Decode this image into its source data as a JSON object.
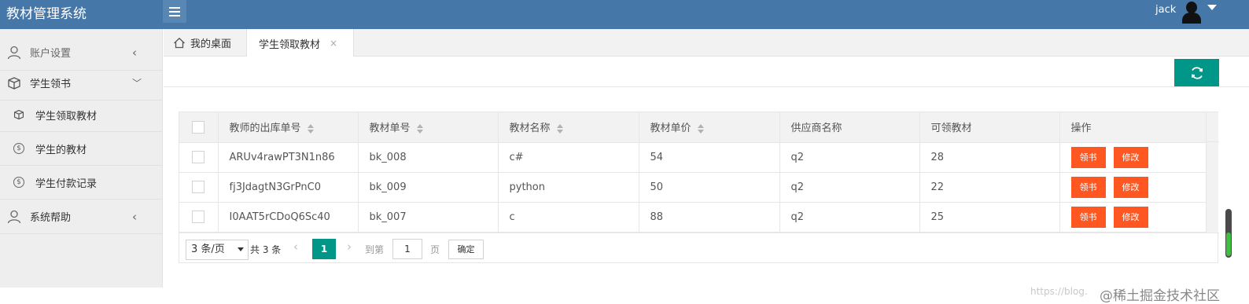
{
  "header": {
    "title": "教材管理系统",
    "user": "jack",
    "menu_icon": "hamburger-icon",
    "accent": "#4577a8"
  },
  "sidebar": {
    "items": [
      {
        "label": "账户设置",
        "icon": "user-icon",
        "arrow": "<"
      },
      {
        "label": "学生领书",
        "icon": "box-icon",
        "arrow": "v"
      },
      {
        "label": "学生领取教材",
        "icon": "box-icon"
      },
      {
        "label": "学生的教材",
        "icon": "dollar-circle-icon"
      },
      {
        "label": "学生付款记录",
        "icon": "dollar-circle-icon"
      },
      {
        "label": "系统帮助",
        "icon": "user-icon",
        "arrow": "<"
      }
    ]
  },
  "tabs": [
    {
      "label": "我的桌面",
      "icon": "home-icon"
    },
    {
      "label": "学生领取教材",
      "close": "×"
    }
  ],
  "table": {
    "columns": [
      "教师的出库单号",
      "教材单号",
      "教材名称",
      "教材单价",
      "供应商名称",
      "可领教材",
      "操作"
    ],
    "rows": [
      {
        "order": "ARUv4rawPT3N1n86",
        "book_id": "bk_008",
        "name": "c#",
        "price": "54",
        "supplier": "q2",
        "qty": "28"
      },
      {
        "order": "fj3JdagtN3GrPnC0",
        "book_id": "bk_009",
        "name": "python",
        "price": "50",
        "supplier": "q2",
        "qty": "22"
      },
      {
        "order": "I0AAT5rCDoQ6Sc40",
        "book_id": "bk_007",
        "name": "c",
        "price": "88",
        "supplier": "q2",
        "qty": "25"
      }
    ],
    "action_claim": "领书",
    "action_edit": "修改",
    "action_color": "#ff5722"
  },
  "pager": {
    "limit": "3 条/页",
    "total": "共 3 条",
    "current": "1",
    "goto_label": "到第",
    "goto_value": "1",
    "page_suffix": "页",
    "confirm": "确定",
    "accent": "#009688"
  },
  "watermark": {
    "faint": "https://blog.",
    "text": "@稀土掘金技术社区"
  }
}
